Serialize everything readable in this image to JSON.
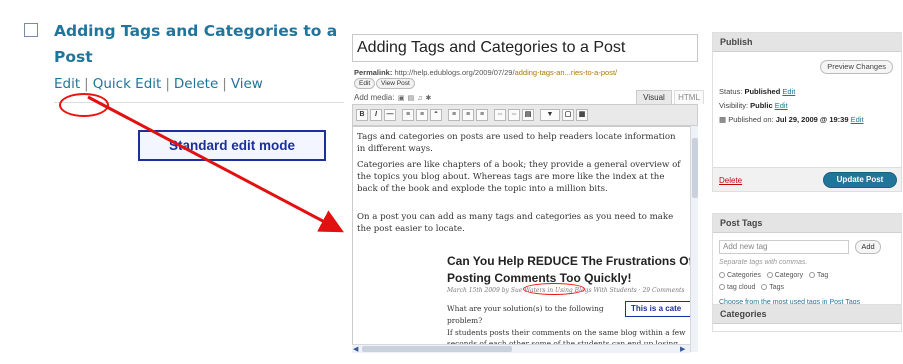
{
  "post_list": {
    "title": "Adding Tags and Categories to a Post",
    "actions": {
      "edit": "Edit",
      "quick_edit": "Quick Edit",
      "delete": "Delete",
      "view": "View"
    }
  },
  "annotation": {
    "label": "Standard edit mode"
  },
  "editor": {
    "title": "Adding Tags and Categories to a Post",
    "permalink_label": "Permalink:",
    "permalink_base": "http://help.edublogs.org/2009/07/29/",
    "permalink_slug": "adding-tags-an...ries-to-a-post/",
    "edit_button": "Edit",
    "view_post_button": "View Post",
    "add_media_label": "Add media:",
    "tab_visual": "Visual",
    "tab_html": "HTML",
    "paragraphs": [
      "Tags and categories on posts are used to help readers locate information in different ways.",
      "Categories are like chapters of a book; they provide a general overview of the topics you blog about. Whereas tags are more like the index at the back of the book and explode the topic into a million bits.",
      "On a post you can add as many tags and categories as you need to make the post easier to locate."
    ],
    "embedded": {
      "title": "Can You Help REDUCE The Frustrations Of Posting Comments Too Quickly!",
      "meta": "March 15th 2009 by Sue Waters in Using Blogs With Students · 29 Comments",
      "callout": "This is a cate",
      "question": "What are your solution(s) to the following problem?",
      "body": "If students posts their comments on the same blog within a few seconds of each other some of the students can end up losing their comments. Then will"
    }
  },
  "sidebar": {
    "publish": {
      "heading": "Publish",
      "preview_button": "Preview Changes",
      "status_label": "Status:",
      "status_value": "Published",
      "visibility_label": "Visibility:",
      "visibility_value": "Public",
      "published_label": "Published on:",
      "published_value": "Jul 29, 2009 @ 19:39",
      "edit_link": "Edit",
      "delete_link": "Delete",
      "update_button": "Update Post"
    },
    "post_tags": {
      "heading": "Post Tags",
      "input_placeholder": "Add new tag",
      "add_button": "Add",
      "hint": "Separate tags with commas.",
      "tags": [
        "Categories",
        "Category",
        "Tag",
        "tag cloud",
        "Tags"
      ],
      "choose_link": "Choose from the most used tags in Post Tags"
    },
    "categories": {
      "heading": "Categories"
    }
  },
  "colors": {
    "link": "#21759b",
    "annotation_red": "#e11111",
    "callout_blue": "#1c2f9b",
    "update_button": "#21759b"
  }
}
